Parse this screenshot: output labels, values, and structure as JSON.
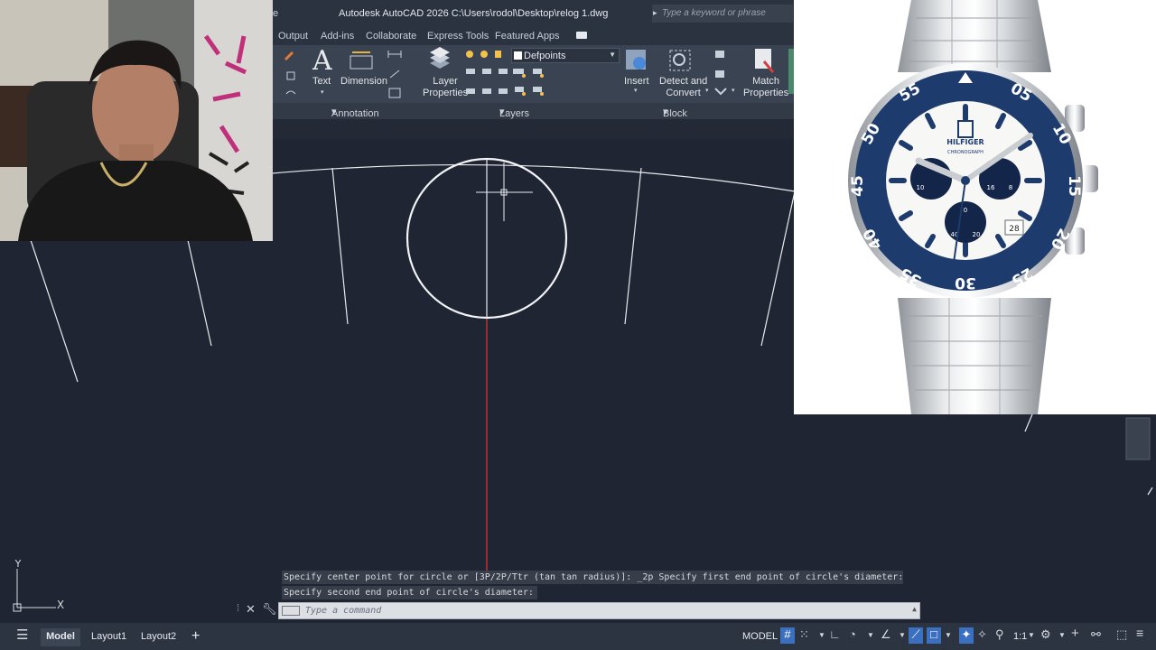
{
  "app": {
    "title": "Autodesk AutoCAD 2026    C:\\Users\\rodol\\Desktop\\relog 1.dwg",
    "title_fragment": "e",
    "search_placeholder": "Type a keyword or phrase"
  },
  "ribbon": {
    "tabs": [
      "Output",
      "Add-ins",
      "Collaborate",
      "Express Tools",
      "Featured Apps"
    ],
    "buttons": {
      "text": "Text",
      "dimension": "Dimension",
      "layer_properties_1": "Layer",
      "layer_properties_2": "Properties",
      "insert": "Insert",
      "detect_1": "Detect and",
      "detect_2": "Convert",
      "match_1": "Match",
      "match_2": "Properties"
    },
    "layer_dropdown": "Defpoints",
    "panels": {
      "annotation": "Annotation",
      "layers": "Layers",
      "block": "Block"
    }
  },
  "watch": {
    "brand": "HILFIGER",
    "subtitle": "CHRONOGRAPH",
    "bezel_numbers": [
      "55",
      "05",
      "10",
      "15",
      "20",
      "25",
      "30",
      "35",
      "40",
      "45",
      "50"
    ],
    "date": "28",
    "subdial_left": [
      "20",
      "10"
    ],
    "subdial_right": [
      "16",
      "8"
    ],
    "subdial_bottom": [
      "0",
      "40",
      "20"
    ]
  },
  "command": {
    "history": [
      "Specify center point for circle or [3P/2P/Ttr (tan tan radius)]: _2p Specify first end point of circle's diameter:",
      "Specify second end point of circle's diameter:"
    ],
    "placeholder": "Type a command"
  },
  "ucs": {
    "y": "Y",
    "x": "X"
  },
  "status": {
    "tabs": [
      "Model",
      "Layout1",
      "Layout2"
    ],
    "add": "+",
    "space": "MODEL",
    "scale": "1:1"
  }
}
